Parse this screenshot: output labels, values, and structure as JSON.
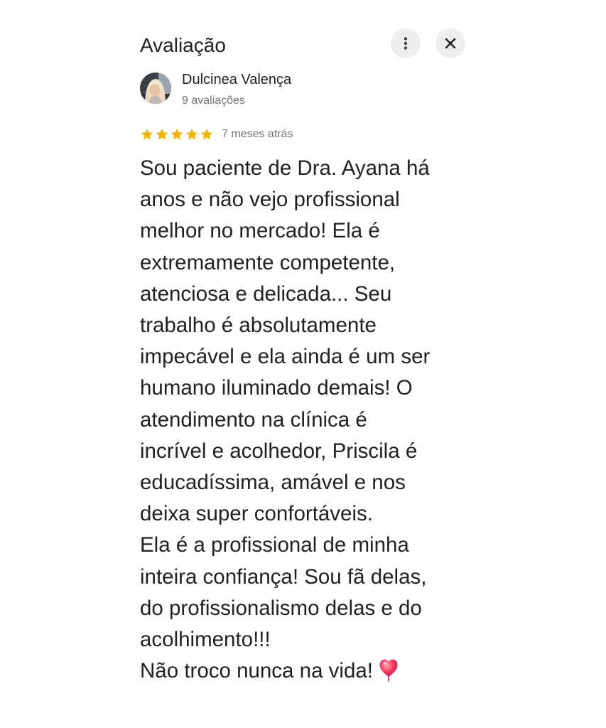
{
  "header": {
    "title": "Avaliação",
    "more_icon": "more-vertical-icon",
    "close_icon": "close-icon"
  },
  "author": {
    "name": "Dulcinea Valença",
    "review_count": "9 avaliações"
  },
  "rating": {
    "stars": 5,
    "max": 5,
    "date": "7 meses atrás",
    "star_color": "#f5b400"
  },
  "review": {
    "lines": [
      "Sou paciente de Dra. Ayana há",
      "anos e não vejo profissional",
      "melhor no mercado! Ela é",
      "extremamente competente,",
      "atenciosa e delicada... Seu",
      "trabalho é absolutamente",
      "impecável e ela ainda é um ser",
      "humano iluminado demais! O",
      "atendimento na clínica é",
      "incrível e acolhedor, Priscila é",
      "educadíssima, amável e nos",
      "deixa super confortáveis.",
      "Ela é a profissional de minha",
      "inteira confiança! Sou fã delas,",
      "do profissionalismo delas e do",
      "acolhimento!!!",
      "Não troco nunca na vida!"
    ],
    "trailing_icon": "heart-icon"
  }
}
